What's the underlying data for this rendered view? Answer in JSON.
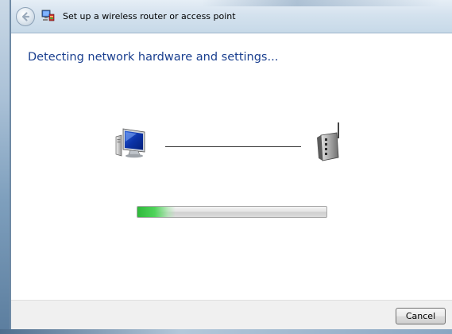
{
  "window": {
    "title": "Set up a wireless router or access point",
    "back_icon": "back-arrow-icon",
    "app_icon": "network-setup-icon"
  },
  "main": {
    "heading": "Detecting network hardware and settings...",
    "computer_icon": "computer-icon",
    "router_icon": "router-icon"
  },
  "progress": {
    "fraction": 0.2,
    "color": "#3cc448"
  },
  "footer": {
    "cancel_label": "Cancel"
  },
  "colors": {
    "heading": "#1a3f8f",
    "frame": "#7e9fbd"
  }
}
